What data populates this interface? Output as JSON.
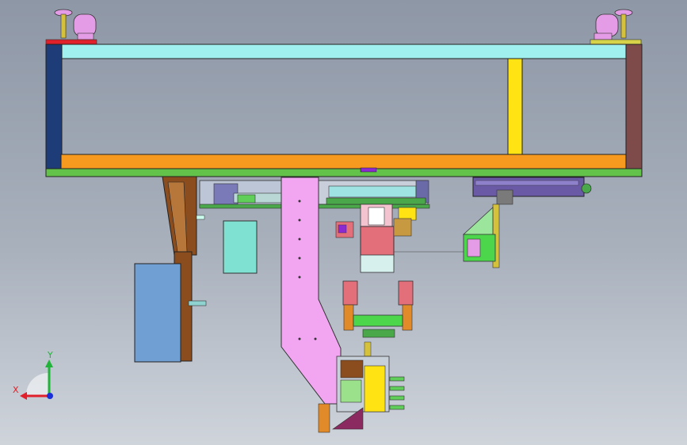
{
  "view": {
    "background_top": "#8e97a6",
    "background_bottom": "#cfd4db"
  },
  "triad": {
    "x_label": "X",
    "y_label": "Y",
    "x_color": "#e0202a",
    "y_color": "#21b33a",
    "z_color": "#1a2fd8"
  },
  "palette": {
    "frame_top_beam": "#9ff0ee",
    "frame_bottom_beam": "#f59a1e",
    "frame_left_post": "#1d3c78",
    "frame_right_post": "#7e4a4a",
    "frame_middle_post": "#ffe312",
    "base_plate": "#62c24a",
    "caster": "#e59ce6",
    "wood": "#8b4d1d",
    "pink_arm": "#f2a6f2",
    "blue_panel": "#6f9fd3",
    "teal_box": "#7ee1d2",
    "red_block": "#e36f7a",
    "green": "#4bd64b"
  }
}
